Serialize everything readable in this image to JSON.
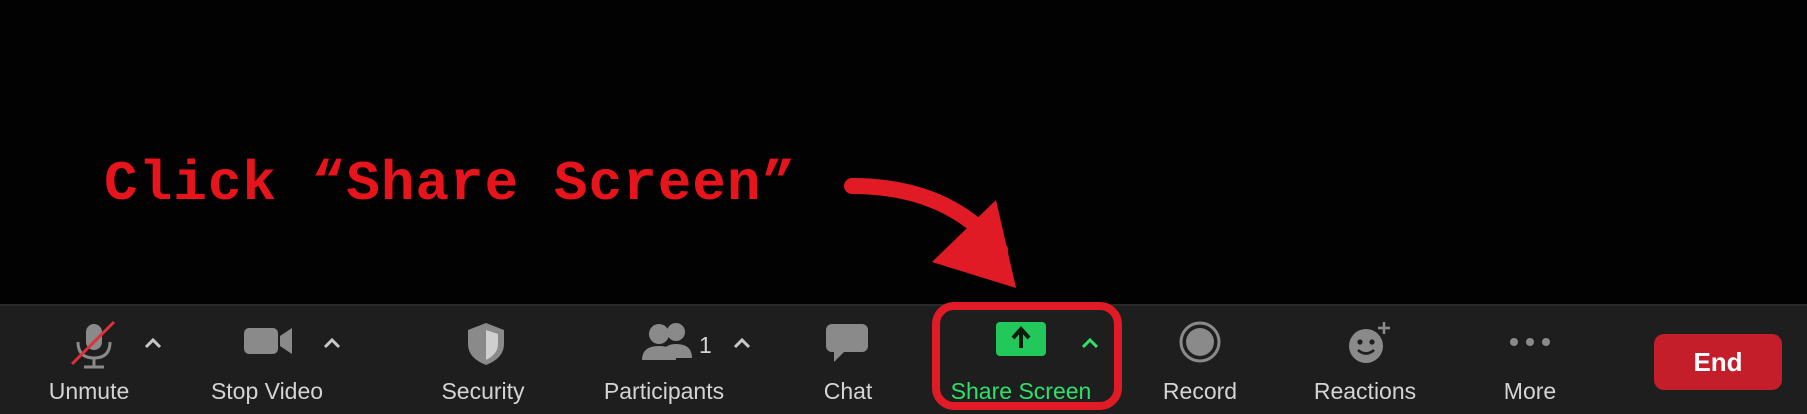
{
  "annotation": {
    "text": "Click “Share Screen”",
    "color": "#e8141c"
  },
  "toolbar": {
    "items": [
      {
        "label": "Unmute",
        "icon": "microphone-muted-icon"
      },
      {
        "label": "Stop Video",
        "icon": "video-camera-icon"
      },
      {
        "label": "Security",
        "icon": "shield-icon"
      },
      {
        "label": "Participants",
        "icon": "participants-icon",
        "count": "1"
      },
      {
        "label": "Chat",
        "icon": "chat-bubble-icon"
      },
      {
        "label": "Share Screen",
        "icon": "share-screen-icon",
        "active": true
      },
      {
        "label": "Record",
        "icon": "record-icon"
      },
      {
        "label": "Reactions",
        "icon": "add-reaction-icon"
      },
      {
        "label": "More",
        "icon": "more-dots-icon"
      }
    ],
    "end_label": "End"
  },
  "colors": {
    "toolbar_bg": "#1e1e1e",
    "share_green": "#2fe06a",
    "end_red": "#c41e2a",
    "highlight_red": "#e01b26"
  }
}
